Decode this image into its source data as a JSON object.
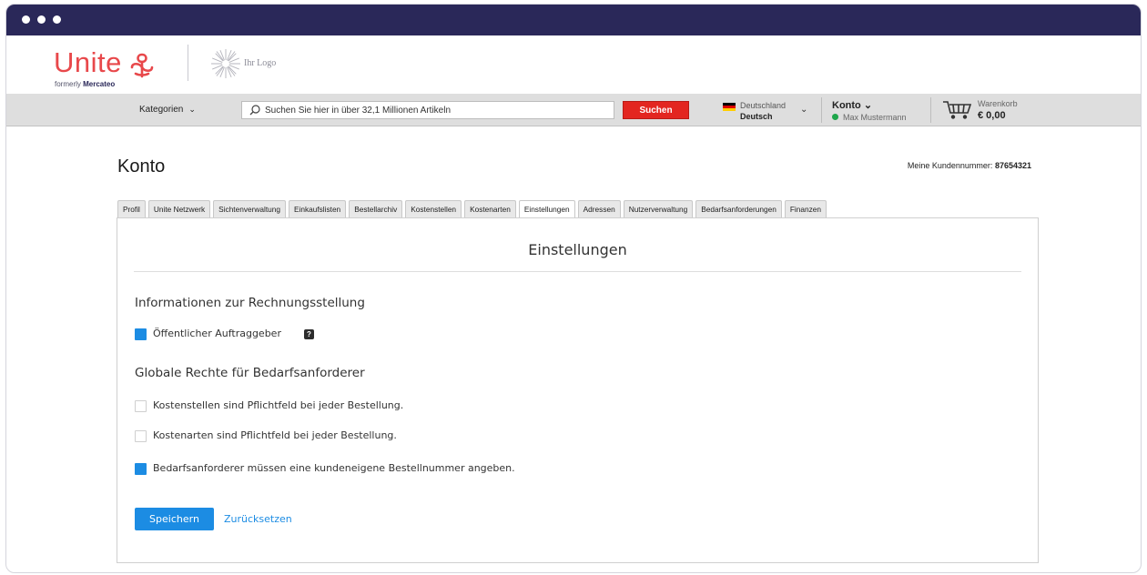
{
  "brand": {
    "name": "Unite",
    "formerly_prefix": "formerly",
    "formerly_name": "Mercateo",
    "client_logo_label": "Ihr Logo",
    "color": "#e8484b"
  },
  "navbar": {
    "categories_label": "Kategorien",
    "search_placeholder": "Suchen Sie hier in über 32,1 Millionen Artikeln",
    "search_button": "Suchen",
    "country": "Deutschland",
    "language": "Deutsch",
    "account_label": "Konto",
    "account_user": "Max Mustermann",
    "cart_label": "Warenkorb",
    "cart_total": "€ 0,00"
  },
  "page": {
    "title": "Konto",
    "customer_number_label": "Meine Kundennummer:",
    "customer_number": "87654321"
  },
  "tabs": [
    {
      "label": "Profil",
      "active": false
    },
    {
      "label": "Unite Netzwerk",
      "active": false
    },
    {
      "label": "Sichtenverwaltung",
      "active": false
    },
    {
      "label": "Einkaufslisten",
      "active": false
    },
    {
      "label": "Bestellarchiv",
      "active": false
    },
    {
      "label": "Kostenstellen",
      "active": false
    },
    {
      "label": "Kostenarten",
      "active": false
    },
    {
      "label": "Einstellungen",
      "active": true
    },
    {
      "label": "Adressen",
      "active": false
    },
    {
      "label": "Nutzerverwaltung",
      "active": false
    },
    {
      "label": "Bedarfsanforderungen",
      "active": false
    },
    {
      "label": "Finanzen",
      "active": false
    }
  ],
  "settings": {
    "title": "Einstellungen",
    "billing_heading": "Informationen zur Rechnungsstellung",
    "public_client_label": "Öffentlicher Auftraggeber",
    "public_client_checked": true,
    "help_glyph": "?",
    "rights_heading": "Globale Rechte für Bedarfsanforderer",
    "cost_centers_label": "Kostenstellen sind Pflichtfeld bei jeder Bestellung.",
    "cost_centers_checked": false,
    "cost_types_label": "Kostenarten sind Pflichtfeld bei jeder Bestellung.",
    "cost_types_checked": false,
    "order_number_label": "Bedarfsanforderer müssen eine kundeneigene Bestellnummer angeben.",
    "order_number_checked": true,
    "save_button": "Speichern",
    "reset_link": "Zurücksetzen"
  },
  "colors": {
    "titlebar": "#2a2859",
    "accent_blue": "#1c8ce3",
    "search_red": "#e32620",
    "online_green": "#1ea64b"
  },
  "icons": {
    "logo_mark": "unite-knot-icon",
    "client_logo": "starburst-logo-icon",
    "search": "search-icon",
    "flag": "german-flag-icon",
    "cart": "cart-icon",
    "chevron": "chevron-down-icon"
  }
}
